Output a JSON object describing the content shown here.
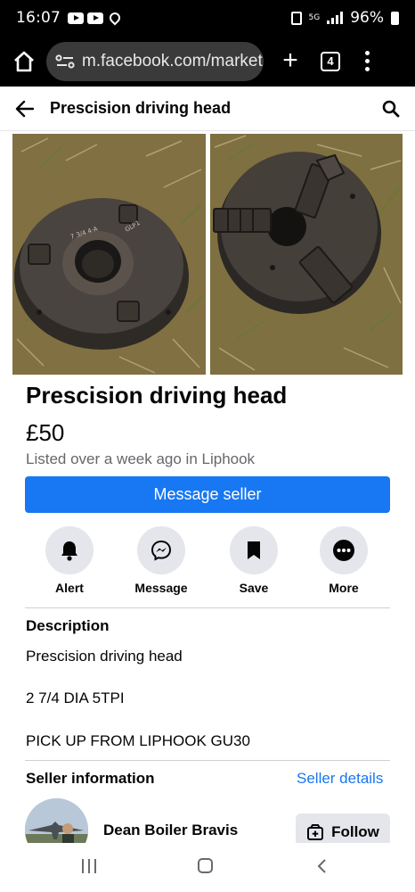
{
  "status_bar": {
    "time": "16:07",
    "battery": "96%",
    "network": "5G"
  },
  "browser": {
    "url": "m.facebook.com/market",
    "tab_count": "4"
  },
  "header": {
    "title": "Prescision driving head"
  },
  "listing": {
    "title": "Prescision driving head",
    "price": "£50",
    "listed": "Listed over a week ago in Liphook",
    "message_seller": "Message seller"
  },
  "actions": [
    {
      "label": "Alert",
      "icon": "bell-icon"
    },
    {
      "label": "Message",
      "icon": "messenger-icon"
    },
    {
      "label": "Save",
      "icon": "bookmark-icon"
    },
    {
      "label": "More",
      "icon": "more-dots-icon"
    }
  ],
  "description": {
    "heading": "Description",
    "lines": [
      "Prescision driving head",
      "2 7/4 DIA 5TPI",
      "PICK UP FROM LIPHOOK GU30"
    ]
  },
  "seller": {
    "heading": "Seller information",
    "details_link": "Seller details",
    "name": "Dean Boiler Bravis",
    "follow": "Follow"
  },
  "colors": {
    "accent": "#1877f2",
    "button_grey": "#e4e6eb",
    "secondary_text": "#65676b"
  }
}
